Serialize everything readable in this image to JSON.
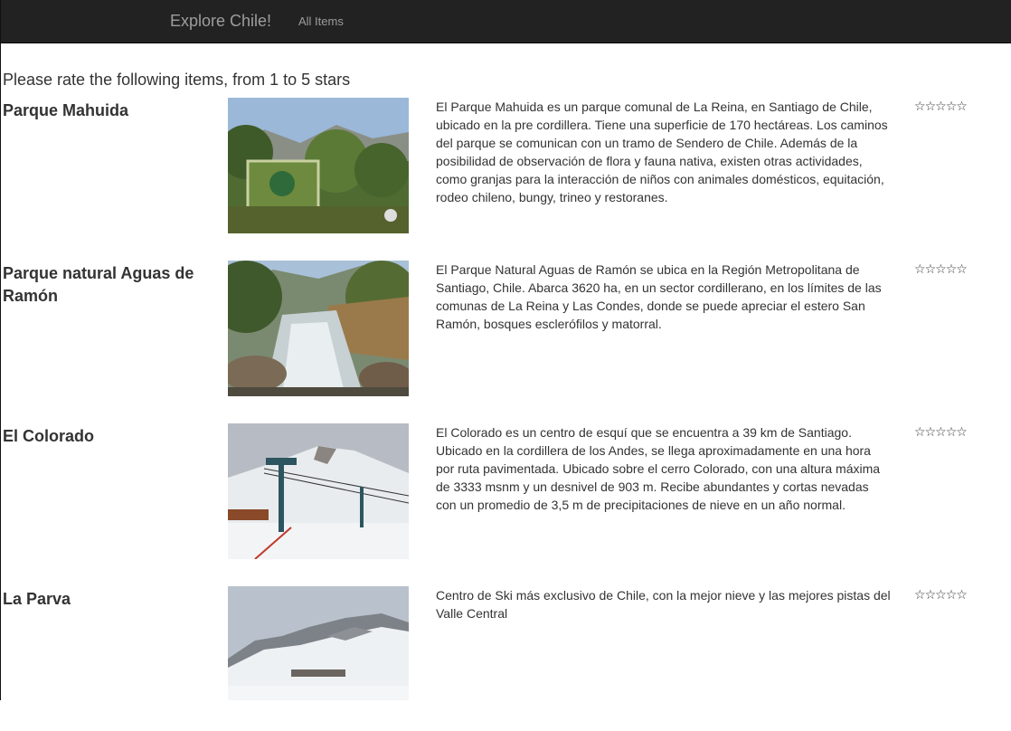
{
  "nav": {
    "brand": "Explore Chile!",
    "all_items": "All Items"
  },
  "intro": "Please rate the following items, from 1 to 5 stars",
  "items": [
    {
      "title": "Parque Mahuida",
      "description": "El Parque Mahuida es un parque comunal de La Reina, en Santiago de Chile, ubicado en la pre cordillera. Tiene una superficie de 170 hectáreas. Los caminos del parque se comunican con un tramo de Sendero de Chile. Además de la posibilidad de observación de flora y fauna nativa, existen otras actividades, como granjas para la interacción de niños con animales domésticos, equitación, rodeo chileno, bungy, trineo y restoranes.",
      "rating": 0
    },
    {
      "title": "Parque natural Aguas de Ramón",
      "description": "El Parque Natural Aguas de Ramón se ubica en la Región Metropolitana de Santiago, Chile. Abarca 3620 ha, en un sector cordillerano, en los límites de las comunas de La Reina y Las Condes, donde se puede apreciar el estero San Ramón, bosques esclerófilos y matorral.",
      "rating": 0
    },
    {
      "title": "El Colorado",
      "description": "El Colorado es un centro de esquí que se encuentra a 39 km de Santiago. Ubicado en la cordillera de los Andes, se llega aproximadamente en una hora por ruta pavimentada. Ubicado sobre el cerro Colorado, con una altura máxima de 3333 msnm y un desnivel de 903 m. Recibe abundantes y cortas nevadas con un promedio de 3,5 m de precipitaciones de nieve en un año normal.",
      "rating": 0
    },
    {
      "title": "La Parva",
      "description": "Centro de Ski más exclusivo de Chile, con la mejor nieve y las mejores pistas del Valle Central",
      "rating": 0
    }
  ],
  "star_glyph": "☆"
}
